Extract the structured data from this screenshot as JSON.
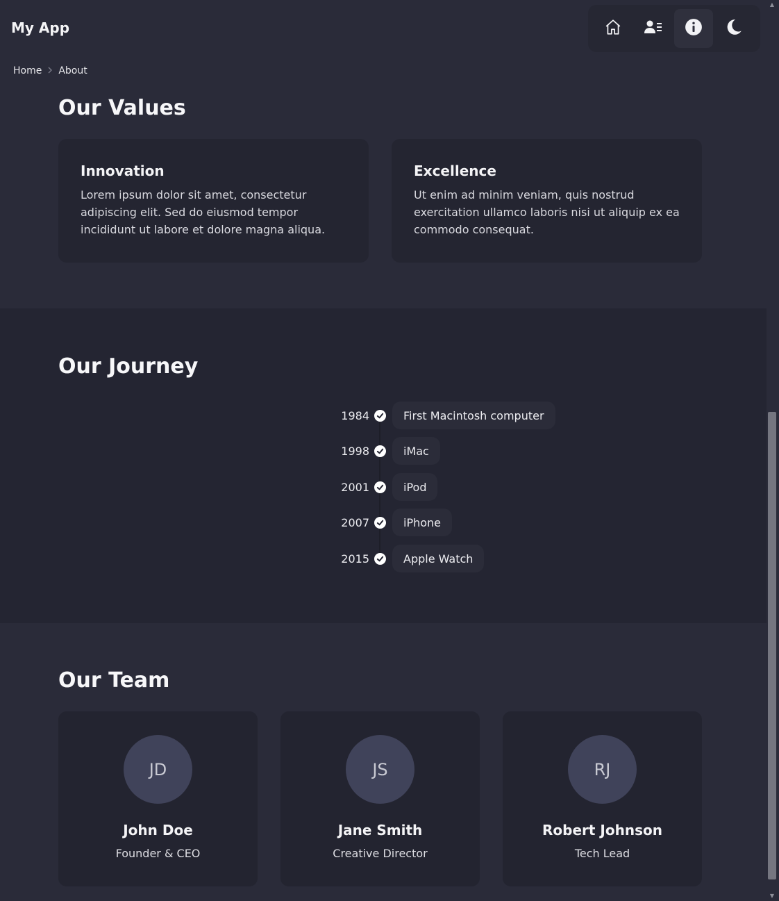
{
  "header": {
    "app_title": "My App",
    "nav": [
      {
        "icon": "home-icon",
        "label": "Home"
      },
      {
        "icon": "users-icon",
        "label": "Team"
      },
      {
        "icon": "info-icon",
        "label": "About",
        "active": true
      },
      {
        "icon": "moon-icon",
        "label": "Theme"
      }
    ]
  },
  "breadcrumb": {
    "home": "Home",
    "current": "About"
  },
  "values": {
    "title": "Our Values",
    "cards": [
      {
        "title": "Innovation",
        "text": "Lorem ipsum dolor sit amet, consectetur adipiscing elit. Sed do eiusmod tempor incididunt ut labore et dolore magna aliqua."
      },
      {
        "title": "Excellence",
        "text": "Ut enim ad minim veniam, quis nostrud exercitation ullamco laboris nisi ut aliquip ex ea commodo consequat."
      }
    ]
  },
  "journey": {
    "title": "Our Journey",
    "items": [
      {
        "year": "1984",
        "event": "First Macintosh computer"
      },
      {
        "year": "1998",
        "event": "iMac"
      },
      {
        "year": "2001",
        "event": "iPod"
      },
      {
        "year": "2007",
        "event": "iPhone"
      },
      {
        "year": "2015",
        "event": "Apple Watch"
      }
    ]
  },
  "team": {
    "title": "Our Team",
    "members": [
      {
        "initials": "JD",
        "name": "John Doe",
        "role": "Founder & CEO"
      },
      {
        "initials": "JS",
        "name": "Jane Smith",
        "role": "Creative Director"
      },
      {
        "initials": "RJ",
        "name": "Robert Johnson",
        "role": "Tech Lead"
      }
    ]
  },
  "colors": {
    "background": "#2a2b39",
    "section_alt": "#242532",
    "card": "#242531",
    "avatar": "#40435a",
    "text": "#f1f1f4"
  }
}
